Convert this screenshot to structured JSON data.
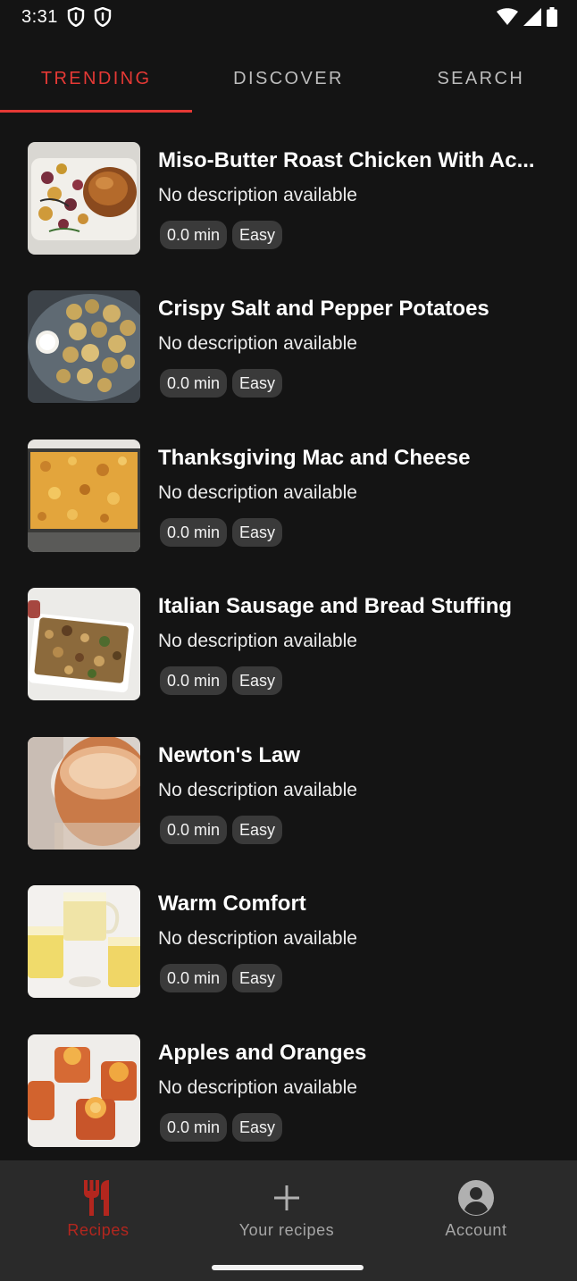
{
  "status_bar": {
    "time": "3:31",
    "left_icons": [
      "shield-icon",
      "shield-icon"
    ],
    "right_icons": [
      "wifi-icon",
      "signal-icon",
      "battery-icon"
    ]
  },
  "tabs": [
    {
      "label": "TRENDING",
      "active": true
    },
    {
      "label": "DISCOVER",
      "active": false
    },
    {
      "label": "SEARCH",
      "active": false
    }
  ],
  "recipes": [
    {
      "title": "Miso-Butter Roast Chicken With Ac...",
      "description": "No description available",
      "time": "0.0 min",
      "difficulty": "Easy",
      "image": "roast-chicken"
    },
    {
      "title": "Crispy Salt and Pepper Potatoes",
      "description": "No description available",
      "time": "0.0 min",
      "difficulty": "Easy",
      "image": "potatoes"
    },
    {
      "title": "Thanksgiving Mac and Cheese",
      "description": "No description available",
      "time": "0.0 min",
      "difficulty": "Easy",
      "image": "mac-and-cheese"
    },
    {
      "title": "Italian Sausage and Bread Stuffing",
      "description": "No description available",
      "time": "0.0 min",
      "difficulty": "Easy",
      "image": "stuffing"
    },
    {
      "title": "Newton's Law",
      "description": "No description available",
      "time": "0.0 min",
      "difficulty": "Easy",
      "image": "cocktail"
    },
    {
      "title": "Warm Comfort",
      "description": "No description available",
      "time": "0.0 min",
      "difficulty": "Easy",
      "image": "tea-mugs"
    },
    {
      "title": "Apples and Oranges",
      "description": "No description available",
      "time": "0.0 min",
      "difficulty": "Easy",
      "image": "orange-drinks"
    }
  ],
  "bottom_nav": [
    {
      "label": "Recipes",
      "icon": "fork-knife-icon",
      "active": true
    },
    {
      "label": "Your recipes",
      "icon": "plus-icon",
      "active": false
    },
    {
      "label": "Account",
      "icon": "account-circle-icon",
      "active": false
    }
  ],
  "colors": {
    "background": "#141414",
    "accent": "#e53935",
    "nav_background": "#2a2a2a",
    "chip_background": "#3a3a3a"
  }
}
